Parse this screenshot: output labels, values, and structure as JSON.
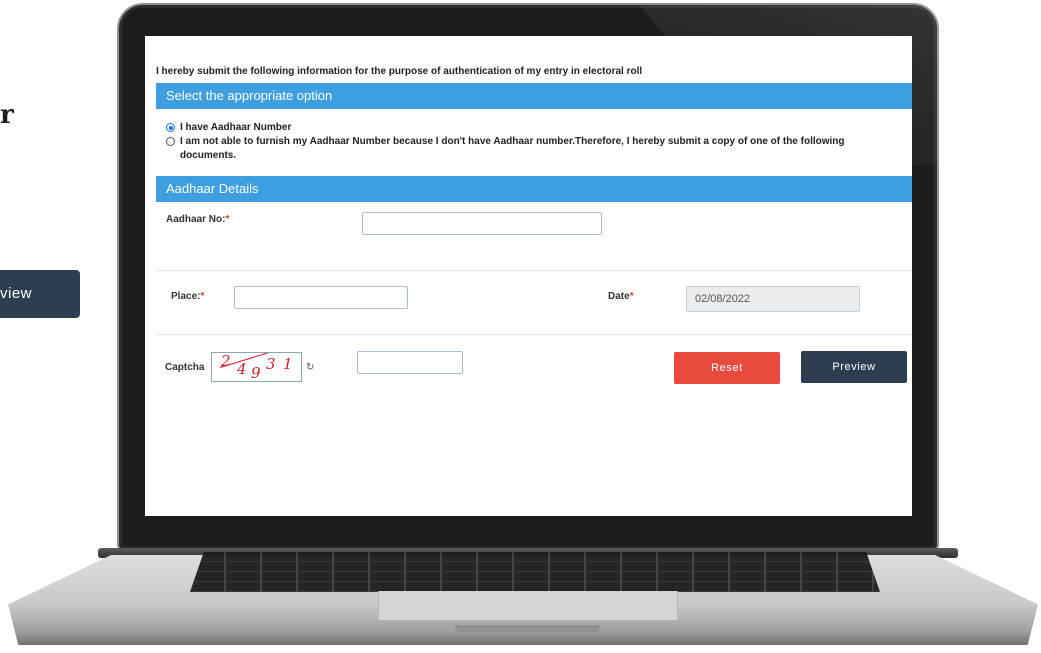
{
  "background": {
    "heading_fragment": "r",
    "button_fragment": "view"
  },
  "form": {
    "intro": "I hereby submit the following information for the purpose of authentication of my entry in electoral roll",
    "option_section": {
      "title": "Select the appropriate option",
      "options": [
        {
          "label": "I have Aadhaar Number",
          "selected": true
        },
        {
          "label": "I am not able to furnish my Aadhaar Number because I don't have Aadhaar number.Therefore, I hereby submit a copy of one of the following documents.",
          "selected": false
        }
      ]
    },
    "aadhaar_section": {
      "title": "Aadhaar Details",
      "aadhaar_no_label": "Aadhaar No:",
      "aadhaar_no_value": ""
    },
    "place_label": "Place:",
    "place_value": "",
    "date_label": "Date",
    "date_value": "02/08/2022",
    "required_mark": "*",
    "captcha": {
      "label": "Captcha",
      "digits": [
        "2",
        "4",
        "9",
        "3",
        "1"
      ],
      "input_value": "",
      "refresh_icon": "refresh-icon"
    },
    "buttons": {
      "reset_label": "Reset",
      "preview_label": "Preview"
    }
  },
  "colors": {
    "section_bar": "#3d9ee0",
    "reset_button": "#e84a3e",
    "preview_button": "#2c3e50",
    "required": "#e53935"
  }
}
